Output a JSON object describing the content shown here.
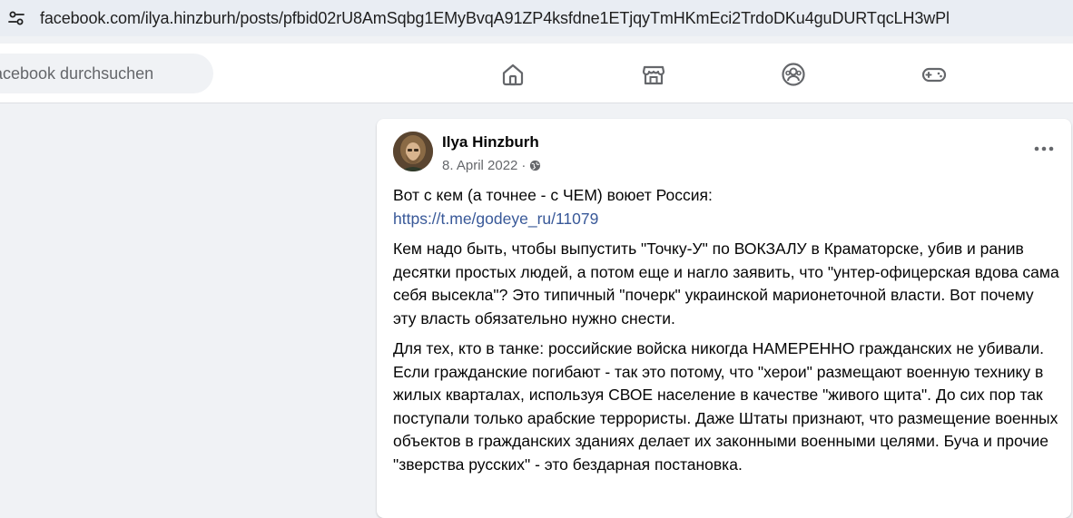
{
  "browser": {
    "url": "facebook.com/ilya.hinzburh/posts/pfbid02rU8AmSqbg1EMyBvqA91ZP4ksfdne1ETjqyTmHKmEci2TrdoDKu4guDURTqcLH3wPl",
    "site_settings_icon": "tune-icon"
  },
  "topnav": {
    "search_placeholder": "Facebook durchsuchen",
    "icons": [
      "home-icon",
      "marketplace-icon",
      "groups-icon",
      "gaming-icon"
    ]
  },
  "post": {
    "author": "Ilya Hinzburh",
    "date": "8. April 2022",
    "separator": "·",
    "audience_icon": "globe-icon",
    "more_icon": "more-options-icon",
    "intro": "Вот с кем (а точнее - с ЧЕМ) воюет Россия:",
    "link": "https://t.me/godeye_ru/11079",
    "paragraph_1": "Кем надо быть, чтобы выпустить \"Точку-У\" по ВОКЗАЛУ в Краматорске, убив и ранив десятки простых людей, а потом еще и нагло заявить, что \"унтер-офицерская вдова сама себя высекла\"? Это типичный \"почерк\" украинской марионеточной власти. Вот почему эту власть обязательно нужно снести.",
    "paragraph_2": "Для тех, кто в танке: российские войска никогда НАМЕРЕННО гражданских не убивали. Если гражданские погибают - так это потому, что \"херои\" размещают военную технику в жилых кварталах, используя СВОЕ население в качестве \"живого щита\". До сих пор так поступали только арабские террористы. Даже Штаты признают, что размещение военных объектов в гражданских зданиях делает их законными военными целями. Буча и прочие \"зверства русских\" - это бездарная постановка."
  },
  "colors": {
    "link": "#385898",
    "text": "#050505",
    "secondary_text": "#65676b",
    "page_bg": "#f0f2f5"
  }
}
